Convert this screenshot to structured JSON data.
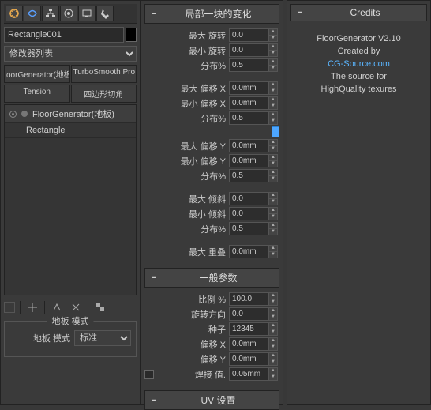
{
  "left": {
    "object_name": "Rectangle001",
    "modlist_label": "修改器列表",
    "btns": [
      "oorGenerator(地板",
      "TurboSmooth Pro",
      "Tension",
      "四边形切角"
    ],
    "stack_header": "FloorGenerator(地板)",
    "stack_sub": "Rectangle",
    "group_floor_mode": "地板 模式",
    "floor_mode_label": "地板 模式",
    "floor_mode_value": "标准"
  },
  "mid": {
    "roll_variation": "局部一块的变化",
    "params_var": [
      {
        "label": "最大 旋转",
        "value": "0.0"
      },
      {
        "label": "最小 旋转",
        "value": "0.0"
      },
      {
        "label": "分布%",
        "value": "0.5"
      }
    ],
    "params_offx": [
      {
        "label": "最大 偏移 X",
        "value": "0.0mm"
      },
      {
        "label": "最小 偏移 X",
        "value": "0.0mm"
      },
      {
        "label": "分布%",
        "value": "0.5"
      }
    ],
    "params_offy": [
      {
        "label": "最大 偏移 Y",
        "value": "0.0mm"
      },
      {
        "label": "最小 偏移 Y",
        "value": "0.0mm"
      },
      {
        "label": "分布%",
        "value": "0.5"
      }
    ],
    "params_tilt": [
      {
        "label": "最大 倾斜",
        "value": "0.0"
      },
      {
        "label": "最小 倾斜",
        "value": "0.0"
      },
      {
        "label": "分布%",
        "value": "0.5"
      }
    ],
    "params_over": [
      {
        "label": "最大 重叠",
        "value": "0.0mm"
      }
    ],
    "roll_general": "一般参数",
    "params_gen": [
      {
        "label": "比例 %",
        "value": "100.0"
      },
      {
        "label": "旋转方向",
        "value": "0.0"
      },
      {
        "label": "种子",
        "value": "12345"
      },
      {
        "label": "偏移 X",
        "value": "0.0mm"
      },
      {
        "label": "偏移 Y",
        "value": "0.0mm"
      },
      {
        "label": "焊接 值.",
        "value": "0.05mm",
        "chk": true
      }
    ],
    "roll_uv": "UV 设置"
  },
  "right": {
    "roll_credits": "Credits",
    "lines": [
      {
        "text": "FloorGenerator V2.10",
        "cls": ""
      },
      {
        "text": "Created by",
        "cls": ""
      },
      {
        "text": "CG-Source.com",
        "cls": "credlink"
      },
      {
        "text": "The source for",
        "cls": ""
      },
      {
        "text": "HighQuality texures",
        "cls": ""
      }
    ]
  }
}
